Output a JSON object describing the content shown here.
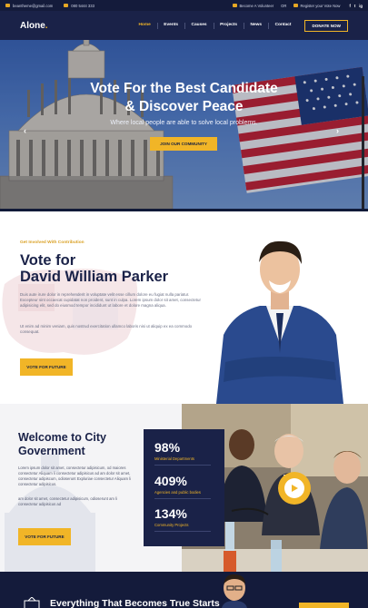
{
  "topbar": {
    "email": "beantheme@gmail.com",
    "phone": "080 5444 333",
    "volunteer": "Become A Volunteer",
    "or": "OR",
    "register": "Register your Vote Now",
    "social": [
      "f",
      "t",
      "ig"
    ]
  },
  "nav": {
    "logo": "Alone",
    "logo_dot": ".",
    "items": [
      "Home",
      "Events",
      "Causes",
      "Projects",
      "News",
      "Contact"
    ],
    "active": "Home",
    "donate": "DONATE NOW"
  },
  "hero": {
    "title_line1": "Vote For the Best Candidate",
    "title_line2": "& Discover Peace",
    "subtitle": "Where local people are able to solve local problems.",
    "button": "JOIN OUR COMMUNITY",
    "prev": "‹",
    "next": "›"
  },
  "candidate": {
    "eyebrow": "Get Involved With Contribution",
    "title_line1": "Vote for",
    "title_line2": "David William Parker",
    "para1": "Duis aute irure dolor in reprehenderit in voluptate velit esse cillum dolore eu fugiat nulla pariatur. Excepteur sint occaecat cupidatat non proident, sunt in culpa. Lorem ipsum dolor sit amet, consectetur adipisicing elit, sed do eiusmod tempor incididunt ut labore et dolore magna aliqua.",
    "para2": "Ut enim ad minim veniam, quis nostrud exercitation ullamco laboris nisi ut aliquip ex ea commodo consequat.",
    "button": "VOTE FOR FUTURE"
  },
  "welcome": {
    "title": "Welcome to City Government",
    "para1": "Lorem ipsum dolor sit amet, consectetur adipisicum, od maiores consectetur Aliquam li consectetur adipisicus ad am dolor sit amet, consectetur adipiscum, odioserunt Expluriae consectetur Aliquam li consectetur adipisicus.",
    "para2": "am dolor sit amet, consectetur adipisicum, odioserunt am li consectetur adipisicus ad",
    "button": "VOTE FOR FUTURE",
    "stats": [
      {
        "num": "98%",
        "label": "Ministerial Departments"
      },
      {
        "num": "409%",
        "label": "Agencies and public bodies"
      },
      {
        "num": "134%",
        "label": "Community Projects"
      }
    ]
  },
  "band": {
    "title": "Everything That Becomes True Starts"
  },
  "colors": {
    "navy": "#1a2248",
    "accent": "#f1b527",
    "topbar": "#141b3b"
  },
  "icons": [
    "email-icon",
    "phone-icon",
    "volunteer-icon",
    "register-icon",
    "facebook-icon",
    "twitter-icon",
    "instagram-icon",
    "arrow-left-icon",
    "arrow-right-icon",
    "play-icon",
    "ballot-icon"
  ]
}
